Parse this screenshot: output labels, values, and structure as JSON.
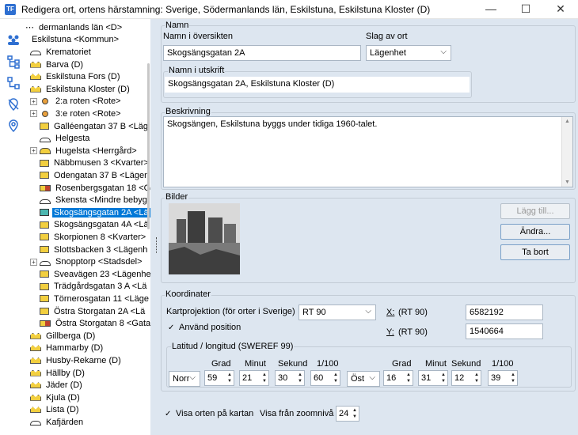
{
  "window": {
    "title": "Redigera ort, ortens härstamning: Sverige, Södermanlands län, Eskilstuna, Eskilstuna Kloster (D)",
    "minimize": "—",
    "maximize": "☐",
    "close": "✕"
  },
  "tree": {
    "items": [
      {
        "label": "dermanlands län <D>",
        "icon": "dots"
      },
      {
        "label": "Eskilstuna <Kommun>",
        "icon": "none"
      },
      {
        "label": "Krematoriet",
        "icon": "house"
      },
      {
        "label": "Barva (D)",
        "icon": "town"
      },
      {
        "label": "Eskilstuna Fors (D)",
        "icon": "town"
      },
      {
        "label": "Eskilstuna Kloster (D)",
        "icon": "town"
      },
      {
        "label": "2:a roten <Rote>",
        "icon": "key",
        "expander": "+"
      },
      {
        "label": "3:e roten <Rote>",
        "icon": "key",
        "expander": "+"
      },
      {
        "label": "Galléengatan 37 B <Läg",
        "icon": "bldg"
      },
      {
        "label": "Helgesta",
        "icon": "house"
      },
      {
        "label": "Hugelsta <Herrgård>",
        "icon": "manor",
        "expander": "+"
      },
      {
        "label": "Näbbmusen 3 <Kvarter>",
        "icon": "bldg"
      },
      {
        "label": "Odengatan 37 B <Läger",
        "icon": "bldg"
      },
      {
        "label": "Rosenbergsgatan 18 <G",
        "icon": "multi"
      },
      {
        "label": "Skensta <Mindre bebyg",
        "icon": "house"
      },
      {
        "label": "Skogsängsgatan 2A <Lä",
        "icon": "bldg-teal",
        "selected": true
      },
      {
        "label": "Skogsängsgatan 4A <Lä",
        "icon": "bldg"
      },
      {
        "label": "Skorpionen 8 <Kvarter>",
        "icon": "bldg"
      },
      {
        "label": "Slottsbacken 3 <Lägenh",
        "icon": "bldg"
      },
      {
        "label": "Snopptorp <Stadsdel>",
        "icon": "house",
        "expander": "+"
      },
      {
        "label": "Sveavägen 23 <Lägenhe",
        "icon": "bldg"
      },
      {
        "label": "Trädgårdsgatan 3 A <Lä",
        "icon": "bldg"
      },
      {
        "label": "Törnerosgatan 11 <Läge",
        "icon": "bldg"
      },
      {
        "label": "Östra Storgatan 2A <Lä",
        "icon": "bldg"
      },
      {
        "label": "Östra Storgatan 8 <Gata",
        "icon": "multi"
      },
      {
        "label": "Gillberga (D)",
        "icon": "town"
      },
      {
        "label": "Hammarby (D)",
        "icon": "town"
      },
      {
        "label": "Husby-Rekarne (D)",
        "icon": "town"
      },
      {
        "label": "Hällby (D)",
        "icon": "town"
      },
      {
        "label": "Jäder (D)",
        "icon": "town"
      },
      {
        "label": "Kjula (D)",
        "icon": "town"
      },
      {
        "label": "Lista (D)",
        "icon": "town"
      },
      {
        "label": "Kafjärden",
        "icon": "house"
      }
    ]
  },
  "namn": {
    "group_title": "Namn",
    "oversikt_label": "Namn i översikten",
    "oversikt_value": "Skogsängsgatan 2A",
    "slag_label": "Slag av ort",
    "slag_value": "Lägenhet",
    "utskrift_title": "Namn i utskrift",
    "utskrift_value": "Skogsängsgatan 2A, Eskilstuna Kloster (D)"
  },
  "beskrivning": {
    "title": "Beskrivning",
    "text": "Skogsängen, Eskilstuna byggs under tidiga 1960-talet."
  },
  "bilder": {
    "title": "Bilder",
    "add_label": "Lägg till...",
    "edit_label": "Ändra...",
    "remove_label": "Ta bort"
  },
  "koordinater": {
    "title": "Koordinater",
    "projection_label": "Kartprojektion (för orter i Sverige)",
    "projection_value": "RT 90",
    "use_position_label": "Använd position",
    "use_position_checked": "✓",
    "x_label": "X:",
    "x_sub": "(RT 90)",
    "x_value": "6582192",
    "y_label": "Y:",
    "y_sub": "(RT 90)",
    "y_value": "1540664",
    "latlon_title": "Latitud / longitud (SWEREF 99)",
    "grad": "Grad",
    "minut": "Minut",
    "sekund": "Sekund",
    "hundradel": "1/100",
    "lat_dir": "Norr",
    "lat_grad": "59",
    "lat_minut": "21",
    "lat_sekund": "30",
    "lat_hundradel": "60",
    "lon_dir": "Öst",
    "lon_grad": "16",
    "lon_minut": "31",
    "lon_sekund": "12",
    "lon_hundradel": "39"
  },
  "footer": {
    "show_on_map_label": "Visa orten på kartan",
    "show_on_map_checked": "✓",
    "zoom_label": "Visa från zoomnivå",
    "zoom_value": "24"
  }
}
